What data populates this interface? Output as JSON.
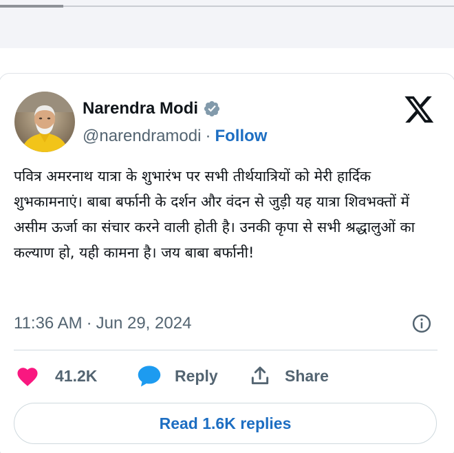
{
  "author": {
    "name": "Narendra Modi",
    "handle": "@narendramodi",
    "separator": "·",
    "follow_label": "Follow",
    "verified_color": "#829aab"
  },
  "tweet": {
    "text": "पवित्र अमरनाथ यात्रा के शुभारंभ पर सभी तीर्थयात्रियों को मेरी हार्दिक शुभकामनाएं। बाबा बर्फानी के दर्शन और वंदन से जुड़ी यह यात्रा शिवभक्तों में असीम ऊर्जा का संचार करने वाली होती है। उनकी कृपा से सभी श्रद्धालुओं का कल्याण हो, यही कामना है। जय बाबा बर्फानी!",
    "time": "11:36 AM",
    "date_separator": "·",
    "date": "Jun 29, 2024"
  },
  "actions": {
    "like_count": "41.2K",
    "reply_label": "Reply",
    "share_label": "Share",
    "read_replies_label": "Read 1.6K replies"
  },
  "icons": {
    "like": "heart-icon",
    "reply": "speech-bubble-icon",
    "share": "share-upload-icon",
    "info": "info-icon",
    "brand": "x-logo-icon",
    "verified": "verified-badge-icon"
  },
  "colors": {
    "heart": "#f91880",
    "reply_bubble": "#1d9bf0",
    "link_blue": "#1d6ec2",
    "muted_text": "#536471"
  }
}
